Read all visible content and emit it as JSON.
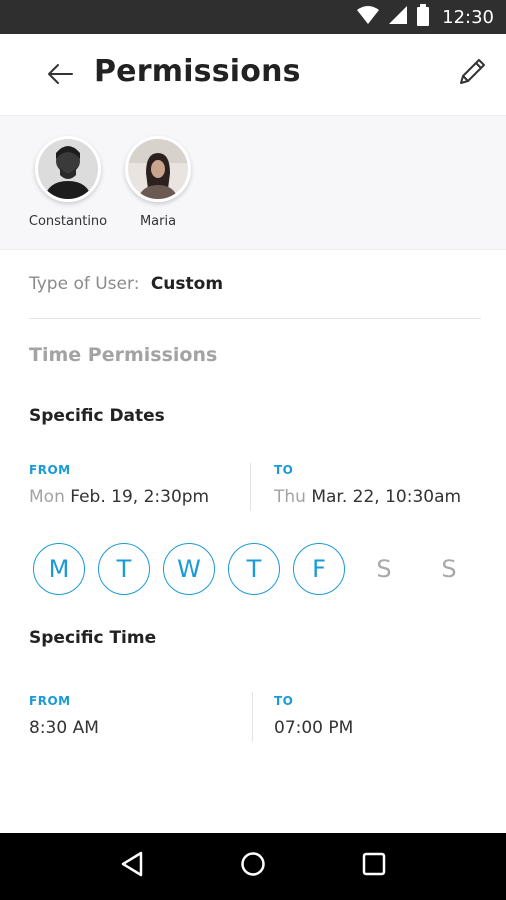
{
  "status_bar": {
    "time": "12:30",
    "icons": [
      "wifi-icon",
      "signal-icon",
      "battery-icon"
    ]
  },
  "header": {
    "title": "Permissions",
    "back_icon": "arrow-left-icon",
    "edit_icon": "pencil-icon"
  },
  "users": [
    {
      "name": "Constantino"
    },
    {
      "name": "Maria"
    }
  ],
  "user_type": {
    "label": "Type of User:",
    "value": "Custom"
  },
  "time_permissions": {
    "title": "Time Permissions",
    "specific_dates": {
      "title": "Specific Dates",
      "from": {
        "label": "FROM",
        "day": "Mon",
        "date": "Feb. 19, 2:30pm"
      },
      "to": {
        "label": "TO",
        "day": "Thu",
        "date": "Mar. 22, 10:30am"
      }
    },
    "days": [
      {
        "letter": "M",
        "selected": true
      },
      {
        "letter": "T",
        "selected": true
      },
      {
        "letter": "W",
        "selected": true
      },
      {
        "letter": "T",
        "selected": true
      },
      {
        "letter": "F",
        "selected": true
      },
      {
        "letter": "S",
        "selected": false
      },
      {
        "letter": "S",
        "selected": false
      }
    ],
    "specific_time": {
      "title": "Specific Time",
      "from": {
        "label": "FROM",
        "time": "8:30 AM"
      },
      "to": {
        "label": "TO",
        "time": "07:00 PM"
      }
    }
  },
  "colors": {
    "accent": "#1a9ad6",
    "status_bar": "#2f2f2f",
    "nav_bar": "#000000"
  },
  "nav_bar": {
    "icons": [
      "back-triangle-icon",
      "home-circle-icon",
      "recents-square-icon"
    ]
  }
}
